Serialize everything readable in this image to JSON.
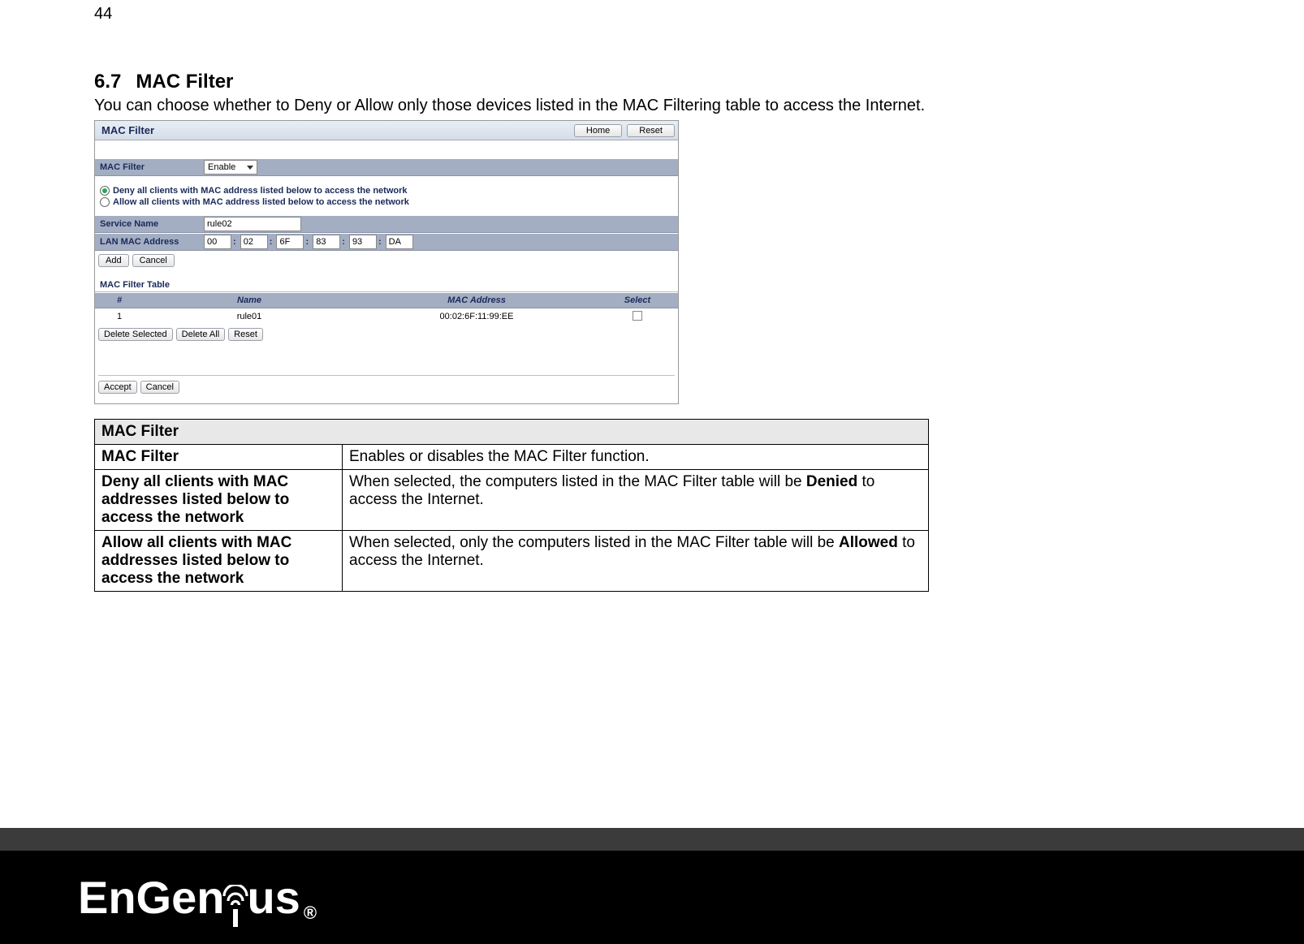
{
  "page_number": "44",
  "heading_number": "6.7",
  "heading_title": "MAC Filter",
  "intro_text": "You can choose whether to Deny or Allow only those devices listed in the MAC Filtering table to access the Internet.",
  "screenshot": {
    "title": "MAC Filter",
    "btn_home": "Home",
    "btn_reset": "Reset",
    "row_macfilter_label": "MAC Filter",
    "row_macfilter_value": "Enable",
    "radio_deny": "Deny all clients with MAC address listed below to access the network",
    "radio_allow": "Allow all clients with MAC address listed below to access the network",
    "row_service_label": "Service Name",
    "row_service_value": "rule02",
    "row_lanmac_label": "LAN MAC Address",
    "mac_parts": [
      "00",
      "02",
      "6F",
      "83",
      "93",
      "DA"
    ],
    "btn_add": "Add",
    "btn_cancel": "Cancel",
    "table_heading": "MAC Filter Table",
    "col_num": "#",
    "col_name": "Name",
    "col_mac": "MAC Address",
    "col_select": "Select",
    "row1_num": "1",
    "row1_name": "rule01",
    "row1_mac": "00:02:6F:11:99:EE",
    "btn_delete_selected": "Delete Selected",
    "btn_delete_all": "Delete All",
    "btn_reset2": "Reset",
    "btn_accept": "Accept",
    "btn_cancel2": "Cancel"
  },
  "desc": {
    "header": "MAC Filter",
    "r1_term": "MAC Filter",
    "r1_desc": "Enables or disables the MAC Filter function.",
    "r2_term": "Deny all clients with MAC addresses listed below to access the network",
    "r2_desc_a": "When selected, the computers listed in the MAC Filter table will be ",
    "r2_desc_bold": "Denied",
    "r2_desc_b": " to access the Internet.",
    "r3_term": "Allow all clients with MAC addresses listed below to access the network",
    "r3_desc_a": "When selected, only the computers listed in the MAC Filter table will be ",
    "r3_desc_bold": "Allowed",
    "r3_desc_b": " to access the Internet."
  },
  "logo_text_a": "EnGen",
  "logo_text_b": "us",
  "logo_reg": "®"
}
